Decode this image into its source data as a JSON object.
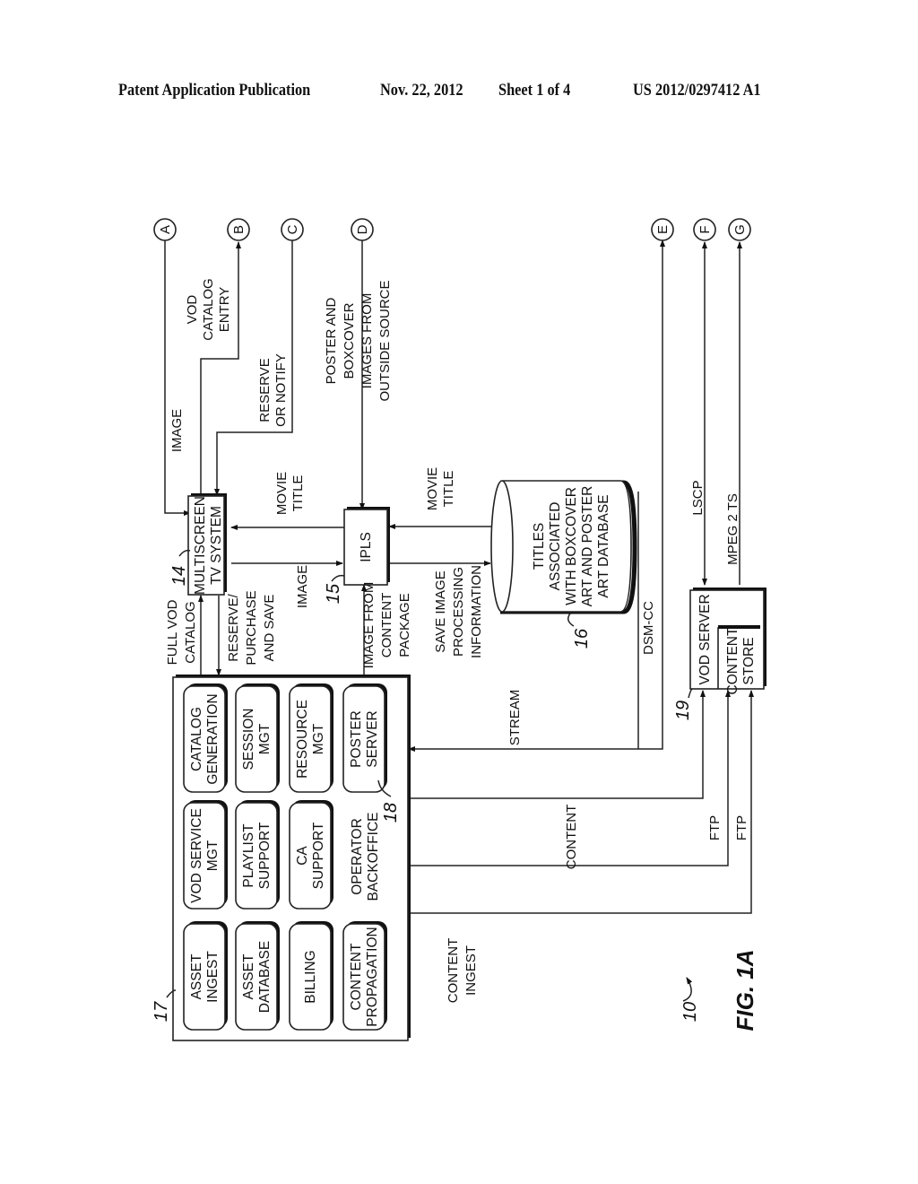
{
  "header": {
    "publication": "Patent Application Publication",
    "date": "Nov. 22, 2012",
    "sheet": "Sheet 1 of 4",
    "number": "US 2012/0297412 A1"
  },
  "figure": {
    "label": "FIG. 1A",
    "system_ref": "10"
  },
  "connectors": [
    "A",
    "B",
    "C",
    "D",
    "E",
    "F",
    "G"
  ],
  "nodes": {
    "multiscreen": {
      "ref": "14",
      "lines": [
        "MULTISCREEN",
        "TV SYSTEM"
      ]
    },
    "ipls": {
      "ref": "15",
      "lines": [
        "IPLS"
      ]
    },
    "database": {
      "ref": "16",
      "lines": [
        "TITLES",
        "ASSOCIATED",
        "WITH BOXCOVER",
        "ART AND POSTER",
        "ART DATABASE"
      ]
    },
    "backoffice": {
      "ref": "17",
      "lines": [
        "OPERATOR",
        "BACKOFFICE"
      ]
    },
    "poster_server_ref": "18",
    "vod_server": {
      "ref": "19",
      "lines": [
        "VOD SERVER"
      ],
      "store_lines": [
        "CONTENT",
        "STORE"
      ]
    }
  },
  "modules": [
    {
      "lines": [
        "ASSET",
        "INGEST"
      ]
    },
    {
      "lines": [
        "VOD SERVICE",
        "MGT"
      ]
    },
    {
      "lines": [
        "CATALOG",
        "GENERATION"
      ]
    },
    {
      "lines": [
        "ASSET",
        "DATABASE"
      ]
    },
    {
      "lines": [
        "PLAYLIST",
        "SUPPORT"
      ]
    },
    {
      "lines": [
        "SESSION",
        "MGT"
      ]
    },
    {
      "lines": [
        "BILLING"
      ]
    },
    {
      "lines": [
        "CA",
        "SUPPORT"
      ]
    },
    {
      "lines": [
        "RESOURCE",
        "MGT"
      ]
    },
    {
      "lines": [
        "CONTENT",
        "PROPAGATION"
      ]
    },
    {
      "lines": [
        "POSTER",
        "SERVER"
      ]
    }
  ],
  "labels": {
    "image_a": [
      "IMAGE"
    ],
    "vod_catalog_entry": [
      "VOD",
      "CATALOG",
      "ENTRY"
    ],
    "reserve_notify": [
      "RESERVE",
      "OR NOTIFY"
    ],
    "poster_boxcover": [
      "POSTER AND",
      "BOXCOVER",
      "IMAGES FROM",
      "OUTSIDE SOURCE"
    ],
    "full_vod_catalog": [
      "FULL VOD",
      "CATALOG"
    ],
    "reserve_purchase": [
      "RESERVE/",
      "PURCHASE",
      "AND SAVE"
    ],
    "movie_title_1": [
      "MOVIE",
      "TITLE"
    ],
    "image_ipls": [
      "IMAGE"
    ],
    "image_from_content": [
      "IMAGE FROM",
      "CONTENT",
      "PACKAGE"
    ],
    "save_image": [
      "SAVE IMAGE",
      "PROCESSING",
      "INFORMATION"
    ],
    "movie_title_2": [
      "MOVIE",
      "TITLE"
    ],
    "dsm_cc": [
      "DSM-CC"
    ],
    "lscp": [
      "LSCP"
    ],
    "mpeg": [
      "MPEG 2 TS"
    ],
    "stream": [
      "STREAM"
    ],
    "content": [
      "CONTENT"
    ],
    "ftp1": [
      "FTP"
    ],
    "ftp2": [
      "FTP"
    ],
    "content_ingest": [
      "CONTENT",
      "INGEST"
    ]
  }
}
